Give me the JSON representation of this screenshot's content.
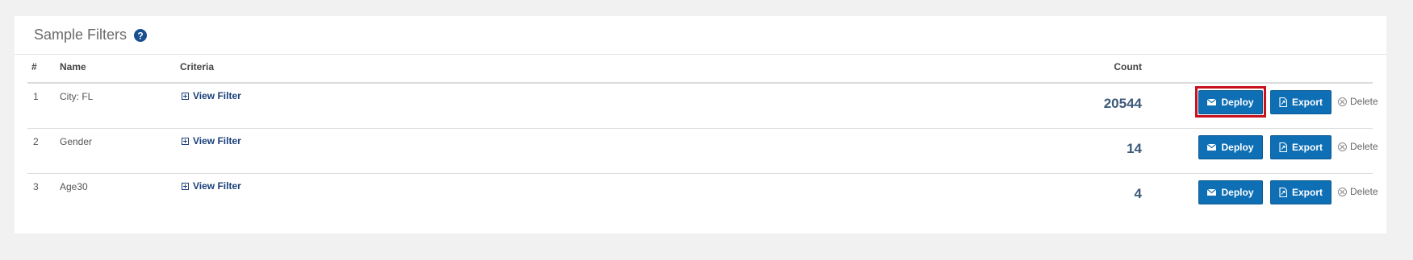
{
  "panel": {
    "title": "Sample Filters",
    "help_icon": "question-circle-icon"
  },
  "table": {
    "headers": [
      "#",
      "Name",
      "Criteria",
      "Count"
    ],
    "rows": [
      {
        "num": "1",
        "name": "City: FL",
        "criteria": "View Filter",
        "count": "20544",
        "deploy": "Deploy",
        "export": "Export",
        "delete": "Delete"
      },
      {
        "num": "2",
        "name": "Gender",
        "criteria": "View Filter",
        "count": "14",
        "deploy": "Deploy",
        "export": "Export",
        "delete": "Delete"
      },
      {
        "num": "3",
        "name": "Age30",
        "criteria": "View Filter",
        "count": "4",
        "deploy": "Deploy",
        "export": "Export",
        "delete": "Delete"
      }
    ]
  },
  "colors": {
    "button_bg": "#0f6fb5",
    "highlight": "#c8101e",
    "link": "#1a3f7a"
  },
  "icons": {
    "deploy": "envelope-icon",
    "export": "file-export-icon",
    "delete": "times-circle-icon",
    "criteria": "plus-square-icon"
  }
}
